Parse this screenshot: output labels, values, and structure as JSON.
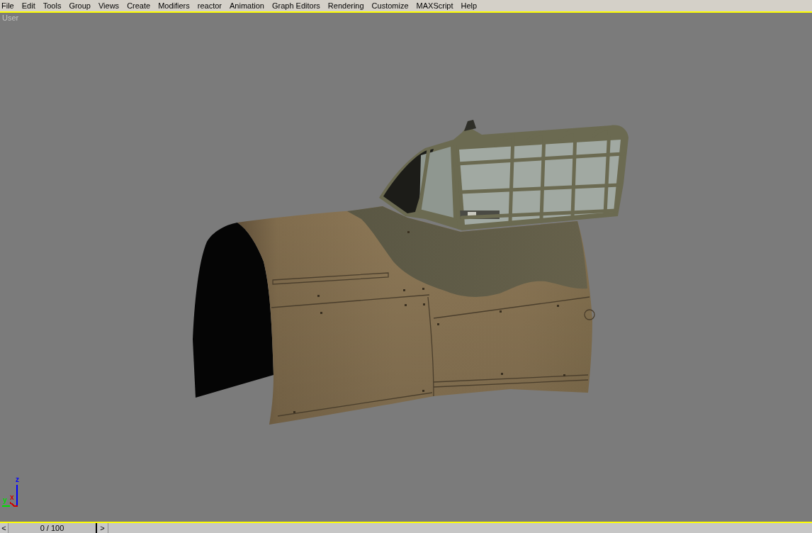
{
  "menu_bar": {
    "items": [
      "File",
      "Edit",
      "Tools",
      "Group",
      "Views",
      "Create",
      "Modifiers",
      "reactor",
      "Animation",
      "Graph Editors",
      "Rendering",
      "Customize",
      "MAXScript",
      "Help"
    ]
  },
  "viewport": {
    "label": "User",
    "active": true,
    "axis_tripod": [
      {
        "label": "z",
        "color": "#0000ff"
      },
      {
        "label": "x",
        "color": "#d00000"
      },
      {
        "label": "y",
        "color": "#00e000"
      }
    ]
  },
  "time_slider": {
    "previous": "<",
    "frame": "0 / 100",
    "next": ">",
    "level": 0
  }
}
